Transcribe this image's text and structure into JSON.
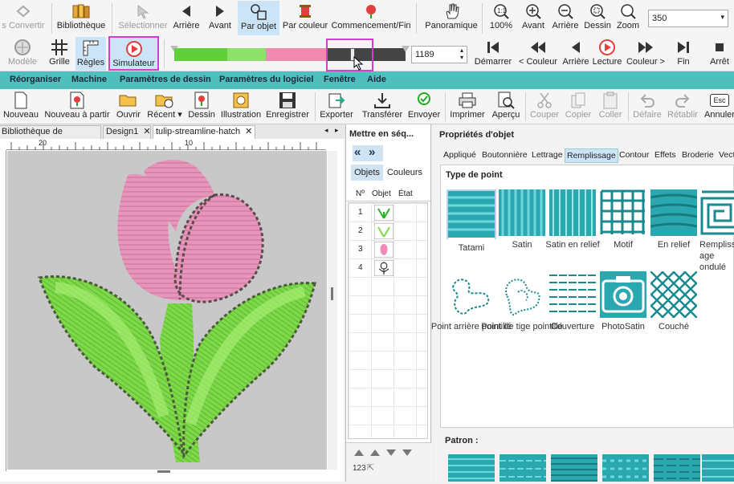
{
  "ribbon1": {
    "convertir_prefix": "s",
    "convertir": "Convertir",
    "bibliotheque": "Bibliothèque",
    "selectionner": "Sélectionner",
    "arriere": "Arrière",
    "avant": "Avant",
    "par_objet": "Par objet",
    "par_couleur": "Par couleur",
    "commencement": "Commencement/Fin",
    "panoramique": "Panoramique",
    "zoom100": "100%",
    "zoom_avant": "Avant",
    "zoom_arriere": "Arrière",
    "zoom_dessin": "Dessin",
    "zoom": "Zoom",
    "zoom_value": "350"
  },
  "ribbon2": {
    "modele": "Modèle",
    "grille": "Grille",
    "regles": "Règles",
    "simulateur": "Simulateur",
    "stitch_count": "1189",
    "demarrer": "Démarrer",
    "prev_couleur": "< Couleur",
    "arriere": "Arrière",
    "lecture": "Lecture",
    "next_couleur": "Couleur >",
    "fin": "Fin",
    "arret": "Arrêt"
  },
  "menu": [
    "Réorganiser",
    "Machine",
    "Paramètres de dessin",
    "Paramètres du logiciel",
    "Fenêtre",
    "Aide"
  ],
  "ribbon3": {
    "nouveau": "Nouveau",
    "nouveau_partir": "Nouveau à partir",
    "ouvrir": "Ouvrir",
    "recent": "Récent",
    "dessin": "Dessin",
    "illustration": "Illustration",
    "enregistrer": "Enregistrer",
    "exporter": "Exporter",
    "transferer": "Transférer",
    "envoyer": "Envoyer",
    "imprimer": "Imprimer",
    "apercu": "Aperçu",
    "couper": "Couper",
    "copier": "Copier",
    "coller": "Coller",
    "defaire": "Défaire",
    "retablir": "Rétablir",
    "annuler": "Annuler",
    "esc": "Esc"
  },
  "doc_tabs": [
    "Bibliothèque de dessins",
    "Design1",
    "tulip-streamline-hatch"
  ],
  "ruler": {
    "t1": "20",
    "t2": "10"
  },
  "sequence": {
    "title": "Mettre en séq...",
    "tab_objets": "Objets",
    "tab_couleurs": "Couleurs",
    "col_num": "Nº",
    "col_objet": "Objet",
    "col_etat": "État",
    "rows": [
      "1",
      "2",
      "3",
      "4"
    ],
    "footer_label": "123"
  },
  "properties": {
    "title": "Propriétés d'objet",
    "tabs": [
      "Appliqué",
      "Boutonnière",
      "Lettrage",
      "Remplissage",
      "Contour",
      "Effets",
      "Broderie",
      "Vect"
    ],
    "type_label": "Type de point",
    "stitches": [
      "Tatami",
      "Satin",
      "Satin en relief",
      "Motif",
      "En relief",
      "Remplissage ondulé",
      "Point arrière pointillé",
      "Point de tige pointillé",
      "Couverture",
      "PhotoSatin",
      "Couché"
    ],
    "patron_label": "Patron :"
  },
  "colors": {
    "teal": "#4fbfbe",
    "stitch": "#2aa8b0",
    "pink": "#e8a0c0",
    "green": "#7ed84a",
    "highlight": "#d63cd0"
  }
}
